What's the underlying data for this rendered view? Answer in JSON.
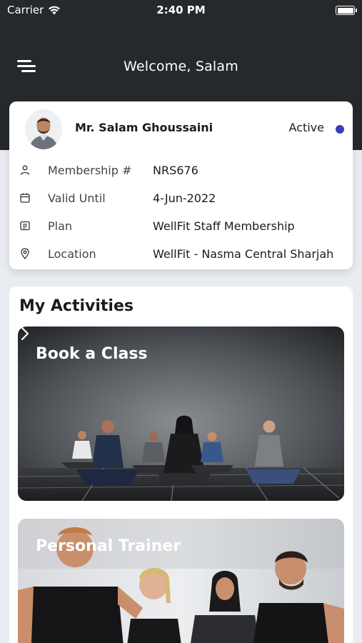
{
  "status_bar": {
    "carrier": "Carrier",
    "time": "2:40 PM"
  },
  "header": {
    "welcome": "Welcome, Salam",
    "menu_icon": "menu-icon"
  },
  "member": {
    "name": "Mr. Salam Ghoussaini",
    "status": "Active",
    "status_color": "#3b3fb5",
    "rows": [
      {
        "icon": "user-icon",
        "label": "Membership #",
        "value": "NRS676"
      },
      {
        "icon": "calendar-icon",
        "label": "Valid Until",
        "value": "4-Jun-2022"
      },
      {
        "icon": "list-icon",
        "label": "Plan",
        "value": "WellFit Staff Membership"
      },
      {
        "icon": "location-pin-icon",
        "label": "Location",
        "value": "WellFit - Nasma Central Sharjah"
      }
    ]
  },
  "activities": {
    "title": "My Activities",
    "cards": [
      {
        "title": "Book a Class",
        "icon": "chevron-right-icon"
      },
      {
        "title": "Personal Trainer"
      }
    ]
  },
  "colors": {
    "header_bg": "#26292c",
    "page_bg": "#e9ecf1",
    "accent": "#3b3fb5"
  }
}
